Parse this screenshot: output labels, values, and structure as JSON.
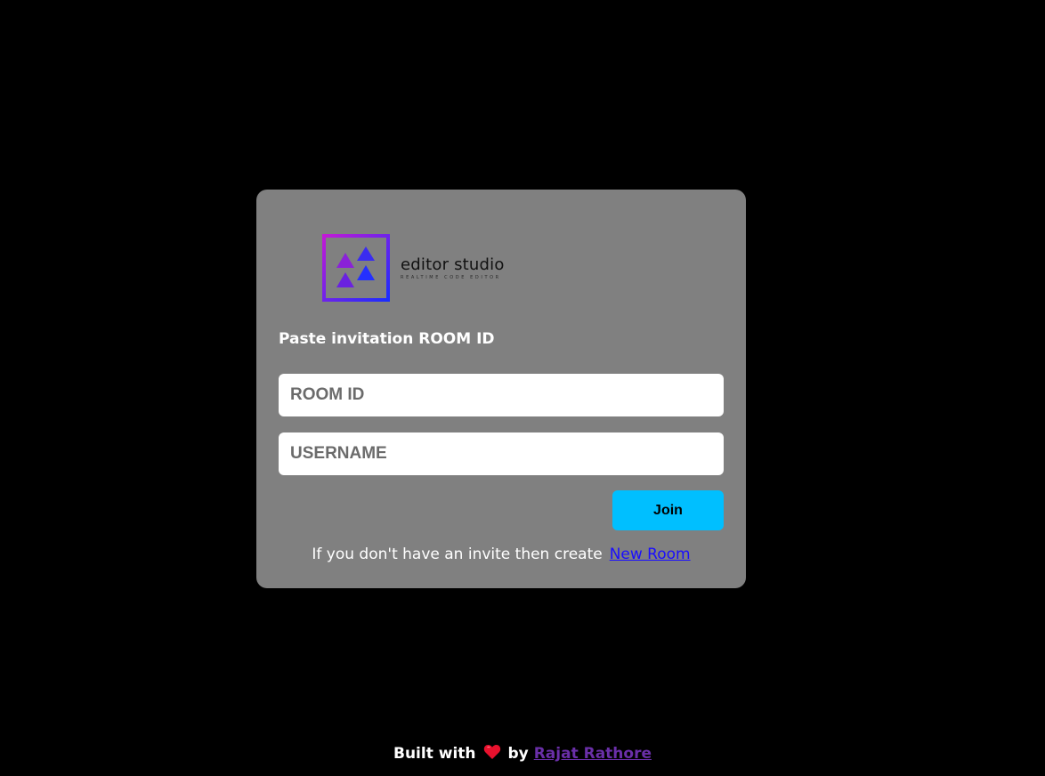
{
  "logo": {
    "title": "editor studio",
    "subtitle": "REALTIME CODE EDITOR",
    "icon": "triangles-logo-icon",
    "gradient": [
      "#c21ad6",
      "#1a2cff"
    ]
  },
  "form": {
    "heading": "Paste invitation ROOM ID",
    "room_id_placeholder": "ROOM ID",
    "room_id_value": "",
    "username_placeholder": "USERNAME",
    "username_value": "",
    "join_label": "Join",
    "invite_text": "If you don't have an invite then create",
    "new_room_link": "New Room"
  },
  "footer": {
    "built_with": "Built with",
    "heart_icon": "heart-icon",
    "by": "by",
    "author_link": "Rajat Rathore"
  },
  "colors": {
    "background": "#000000",
    "card": "#808080",
    "join_button": "#00bfff",
    "link": "#1a0dff",
    "author_link": "#6a2fa8",
    "heart": "#e8112d"
  }
}
